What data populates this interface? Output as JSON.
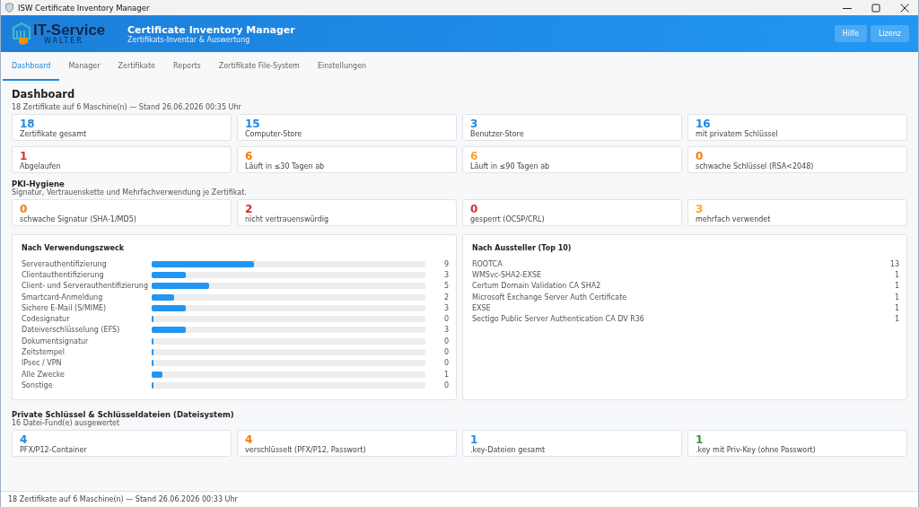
{
  "window": {
    "title": "ISW Certificate Inventory Manager"
  },
  "header": {
    "logo_name": "IT-Service",
    "logo_sub": "WALTER",
    "title": "Certificate Inventory Manager",
    "subtitle": "Zertifikats-Inventar & Auswertung",
    "buttons": [
      "Hilfe",
      "Lizenz"
    ]
  },
  "tabs": [
    {
      "label": "Dashboard",
      "selected": true
    },
    {
      "label": "Manager",
      "selected": false
    },
    {
      "label": "Zertifikate",
      "selected": false
    },
    {
      "label": "Reports",
      "selected": false
    },
    {
      "label": "Zertifikate File-System",
      "selected": false
    },
    {
      "label": "Einstellungen",
      "selected": false
    }
  ],
  "page": {
    "title": "Dashboard",
    "summary": "18 Zertifikate auf 6 Maschine(n) — Stand 26.06.2026 00:35 Uhr"
  },
  "stats": [
    {
      "value": "18",
      "label": "Zertifikate gesamt",
      "color": "#1e88e5"
    },
    {
      "value": "15",
      "label": "Computer-Store",
      "color": "#1e88e5"
    },
    {
      "value": "3",
      "label": "Benutzer-Store",
      "color": "#1e88e5"
    },
    {
      "value": "16",
      "label": "mit privatem Schlüssel",
      "color": "#1e88e5"
    },
    {
      "value": "1",
      "label": "Abgelaufen",
      "color": "#d32f2f"
    },
    {
      "value": "6",
      "label": "Läuft in ≤30 Tagen ab",
      "color": "#f57c00"
    },
    {
      "value": "6",
      "label": "Läuft in ≤90 Tagen ab",
      "color": "#f9a825"
    },
    {
      "value": "0",
      "label": "schwache Schlüssel (RSA<2048)",
      "color": "#f57c00"
    }
  ],
  "pki_hygiene": {
    "title": "PKI-Hygiene",
    "subtitle": "Signatur, Vertrauenskette und Mehrfachverwendung je Zertifikat.",
    "stats": [
      {
        "value": "0",
        "label": "schwache Signatur (SHA-1/MD5)",
        "color": "#f57c00"
      },
      {
        "value": "2",
        "label": "nicht vertrauenswürdig",
        "color": "#d32f2f"
      },
      {
        "value": "0",
        "label": "gesperrt (OCSP/CRL)",
        "color": "#d32f2f"
      },
      {
        "value": "3",
        "label": "mehrfach verwendet",
        "color": "#f9a825"
      }
    ]
  },
  "usage": {
    "title": "Nach Verwendungszweck",
    "rows": [
      {
        "name": "Serverauthentifizierung",
        "level": 0.375,
        "count": "9"
      },
      {
        "name": "Clientauthentifizierung",
        "level": 0.125,
        "count": "3"
      },
      {
        "name": "Client- und Serverauthentifizierung",
        "level": 0.21,
        "count": "5"
      },
      {
        "name": "Smartcard-Anmeldung",
        "level": 0.083,
        "count": "2"
      },
      {
        "name": "Sichere E-Mail (S/MIME)",
        "level": 0.125,
        "count": "3"
      },
      {
        "name": "Codesignatur",
        "level": 0,
        "count": "0"
      },
      {
        "name": "Dateiverschlüsselung (EFS)",
        "level": 0.125,
        "count": "3"
      },
      {
        "name": "Dokumentsignatur",
        "level": 0,
        "count": "0"
      },
      {
        "name": "Zeitstempel",
        "level": 0,
        "count": "0"
      },
      {
        "name": "IPsec / VPN",
        "level": 0,
        "count": "0"
      },
      {
        "name": "Alle Zwecke",
        "level": 0.04,
        "count": "1"
      },
      {
        "name": "Sonstige",
        "level": 0,
        "count": "0"
      }
    ]
  },
  "issuers": {
    "title": "Nach Aussteller (Top 10)",
    "rows": [
      {
        "name": "ROOTCA",
        "count": "13"
      },
      {
        "name": "WMSvc-SHA2-EXSE",
        "count": "1"
      },
      {
        "name": "Certum Domain Validation CA SHA2",
        "count": "1"
      },
      {
        "name": "Microsoft Exchange Server Auth Certificate",
        "count": "1"
      },
      {
        "name": "EXSE",
        "count": "1"
      },
      {
        "name": "Sectigo Public Server Authentication CA DV R36",
        "count": "1"
      }
    ]
  },
  "private_keys": {
    "title": "Private Schlüssel & Schlüsseldateien (Dateisystem)",
    "subtitle": "16 Datei-Fund(e) ausgewertet",
    "stats": [
      {
        "value": "4",
        "label": "PFX/P12-Container",
        "color": "#1e88e5"
      },
      {
        "value": "4",
        "label": "verschlüsselt (PFX/P12, Passwort)",
        "color": "#f57c00"
      },
      {
        "value": "1",
        "label": ".key-Dateien gesamt",
        "color": "#1e88e5"
      },
      {
        "value": "1",
        "label": ".key mit Priv-Key (ohne Passwort)",
        "color": "#388e3c"
      }
    ]
  },
  "status_bar": "18 Zertifikate auf 6 Maschine(n) — Stand 26.06.2026 00:33 Uhr"
}
